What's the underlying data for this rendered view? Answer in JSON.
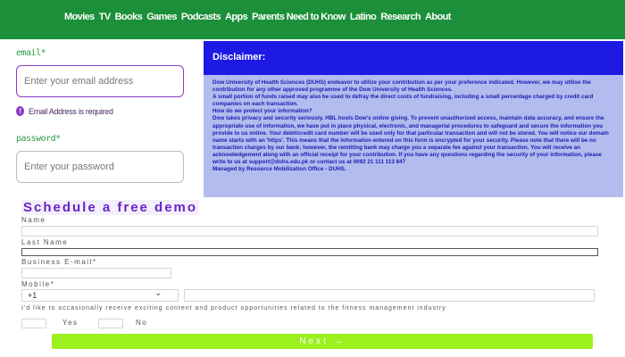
{
  "nav": {
    "items": [
      "Movies",
      "TV",
      "Books",
      "Games",
      "Podcasts",
      "Apps",
      "Parents Need to Know",
      "Latino",
      "Research",
      "About"
    ]
  },
  "login": {
    "email_label": "email*",
    "email_placeholder": "Enter your email address",
    "email_error": "Email Address is required",
    "password_label": "password*",
    "password_placeholder": "Enter your password"
  },
  "disclaimer": {
    "heading": "Disclaimer:",
    "lines": [
      "Dow University of Health Sciences (DUHS) endeavor to utilize your contribution as per your preference indicated. However, we may utilise the contribution for any other approved programme of the Dow University of Health Sciences.",
      "A small portion of funds raised may also be used to defray the direct costs of fundraising, including a small percentage charged by credit card companies on each transaction.",
      "How do we protect your information?",
      "Dow takes privacy and security seriously. HBL hosts Dow's online giving. To prevent unauthorized access, maintain data accuracy, and ensure the appropriate use of information, we have put in place physical, electronic, and managerial procedures to safeguard and secure the information you provide to us online. Your debit/credit card number will be used only for that particular transaction and will not be stored. You will notice our domain name starts with an 'https'. This means that the information entered on this form is encrypted for your security. Please note that there will be no transaction charges by our bank; however, the remitting bank may charge you a separate fee against your transaction. You will receive an acknowledgement along with an official receipt for your contribution. If you have any questions regarding the security of your information, please write to us at support@duhs.edu.pk or contact us at 0092 21 111 113 847",
      "Managed by Resource Mobilization Office - DUHS."
    ]
  },
  "demo": {
    "title": "Schedule a free demo",
    "name_label": "Name",
    "last_name_label": "Last Name",
    "business_email_label": "Business E-mail*",
    "mobile_label": "Mobile*",
    "country_code": "+1",
    "consent_text": "I'd like to occasionally receive exciting content and product opportunities related to the fitness management industry",
    "yes_label": "Yes",
    "no_label": "No",
    "next_label": "Next →"
  },
  "colors": {
    "nav_bg": "#1c8f3a",
    "disclaimer_header": "#1c1ae3",
    "disclaimer_bg": "#b3bcef",
    "demo_title": "#6a22c8",
    "next_button": "#9cf01e",
    "error_accent": "#8e3ac7"
  }
}
